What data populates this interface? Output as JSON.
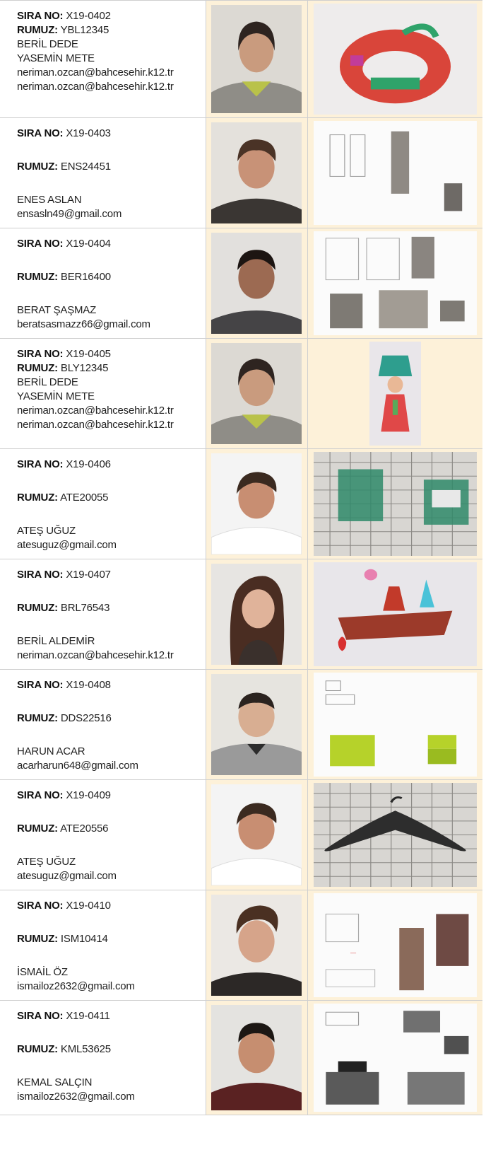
{
  "labels": {
    "sira": "SIRA NO:",
    "rumuz": "RUMUZ:"
  },
  "entries": [
    {
      "sira_no": "X19-0402",
      "rumuz": "YBL12345",
      "lines": [
        "BERİL DEDE",
        "YASEMİN METE",
        "neriman.ozcan@bahcesehir.k12.tr",
        "neriman.ozcan@bahcesehir.k12.tr"
      ]
    },
    {
      "sira_no": "X19-0403",
      "rumuz": "ENS24451",
      "lines": [
        "ENES ASLAN",
        "ensasln49@gmail.com"
      ]
    },
    {
      "sira_no": "X19-0404",
      "rumuz": "BER16400",
      "lines": [
        "BERAT ŞAŞMAZ",
        "beratsasmazz66@gmail.com"
      ]
    },
    {
      "sira_no": "X19-0405",
      "rumuz": "BLY12345",
      "lines": [
        "BERİL DEDE",
        "YASEMİN METE",
        "neriman.ozcan@bahcesehir.k12.tr",
        "neriman.ozcan@bahcesehir.k12.tr"
      ]
    },
    {
      "sira_no": "X19-0406",
      "rumuz": "ATE20055",
      "lines": [
        "ATEŞ UĞUZ",
        "atesuguz@gmail.com"
      ]
    },
    {
      "sira_no": "X19-0407",
      "rumuz": "BRL76543",
      "lines": [
        "BERİL ALDEMİR",
        "neriman.ozcan@bahcesehir.k12.tr"
      ]
    },
    {
      "sira_no": "X19-0408",
      "rumuz": "DDS22516",
      "lines": [
        "HARUN ACAR",
        "acarharun648@gmail.com"
      ]
    },
    {
      "sira_no": "X19-0409",
      "rumuz": "ATE20556",
      "lines": [
        "ATEŞ UĞUZ",
        "atesuguz@gmail.com"
      ]
    },
    {
      "sira_no": "X19-0410",
      "rumuz": "ISM10414",
      "lines": [
        "İSMAİL ÖZ",
        "ismailoz2632@gmail.com"
      ]
    },
    {
      "sira_no": "X19-0411",
      "rumuz": "KML53625",
      "lines": [
        "KEMAL SALÇIN",
        "ismailoz2632@gmail.com"
      ]
    }
  ],
  "colors": {
    "cell_bg": "#fdf1d9",
    "border": "#cfcfcf",
    "text": "#222222"
  }
}
